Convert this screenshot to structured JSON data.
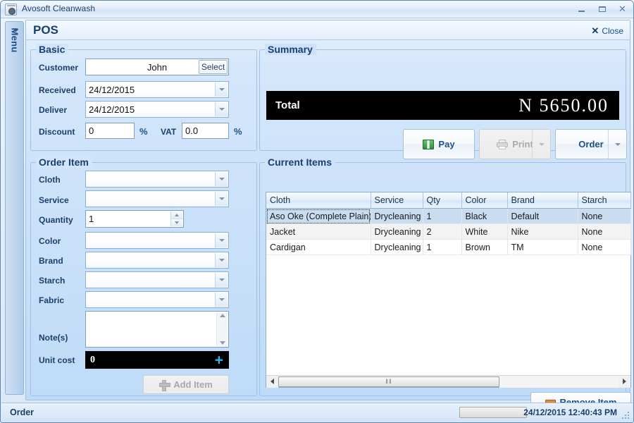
{
  "window": {
    "title": "Avosoft Cleanwash",
    "icon": "washing-machine-icon",
    "minimize_label": "–",
    "maximize_label": "□",
    "close_label": "✕"
  },
  "sidebar": {
    "expand_chevron": "»",
    "label": "Menu"
  },
  "page": {
    "title": "POS",
    "close_label": "Close",
    "close_icon": "x-icon"
  },
  "basic": {
    "legend": "Basic",
    "customer": {
      "label": "Customer",
      "value": "John",
      "placeholder": "",
      "select_button": "Select"
    },
    "received": {
      "label": "Received",
      "value": "24/12/2015"
    },
    "deliver": {
      "label": "Deliver",
      "value": "24/12/2015"
    },
    "discount": {
      "label": "Discount",
      "value": "0",
      "unit": "%"
    },
    "vat": {
      "label": "VAT",
      "value": "0.0",
      "unit": "%"
    }
  },
  "summary": {
    "legend": "Summary",
    "total_label": "Total",
    "total_value": "N 5650.00",
    "buttons": [
      {
        "label": "Pay",
        "icon": "money-icon",
        "enabled": true,
        "dropdown": false
      },
      {
        "label": "Print",
        "icon": "printer-icon",
        "enabled": false,
        "dropdown": true
      },
      {
        "label": "Order",
        "icon": "",
        "enabled": true,
        "dropdown": true
      }
    ]
  },
  "order_item": {
    "legend": "Order Item",
    "fields": [
      {
        "label": "Cloth",
        "value": "",
        "type": "combo"
      },
      {
        "label": "Service",
        "value": "",
        "type": "combo"
      },
      {
        "label": "Quantity",
        "value": "1",
        "type": "spinner"
      },
      {
        "label": "Color",
        "value": "",
        "type": "combo"
      },
      {
        "label": "Brand",
        "value": "",
        "type": "combo"
      },
      {
        "label": "Starch",
        "value": "",
        "type": "combo"
      },
      {
        "label": "Fabric",
        "value": "",
        "type": "combo"
      },
      {
        "label": "Note(s)",
        "value": "",
        "type": "textarea"
      }
    ],
    "unit_cost": {
      "label": "Unit cost",
      "value": "0",
      "plus_icon": "plus-icon"
    },
    "add_item_button": {
      "label": "Add Item",
      "icon": "plus-icon",
      "enabled": false
    }
  },
  "current_items": {
    "legend": "Current Items",
    "columns": [
      "Cloth",
      "Service",
      "Qty",
      "Color",
      "Brand",
      "Starch"
    ],
    "rows": [
      {
        "cloth": "Aso Oke (Complete Plain)",
        "service": "Drycleaning",
        "qty": "1",
        "color": "Black",
        "brand": "Default",
        "starch": "None",
        "selected": true
      },
      {
        "cloth": "Jacket",
        "service": "Drycleaning",
        "qty": "2",
        "color": "White",
        "brand": "Nike",
        "starch": "None",
        "selected": false
      },
      {
        "cloth": "Cardigan",
        "service": "Drycleaning",
        "qty": "1",
        "color": "Brown",
        "brand": "TM",
        "starch": "None",
        "selected": false
      }
    ],
    "remove_button": {
      "label": "Remove Item",
      "icon": "minus-icon"
    },
    "hscroll_grip": "‖‖"
  },
  "statusbar": {
    "status": "Order",
    "timestamp": "24/12/2015 12:40:43 PM"
  },
  "colors": {
    "accent": "#1b4f86",
    "panel_bg": "#bfdbf8",
    "display_bg": "#000000",
    "display_fg": "#ffffff",
    "selection": "#c9dcf0",
    "plus_icon": "#2fb6e8",
    "remove_icon": "#d3571a"
  }
}
